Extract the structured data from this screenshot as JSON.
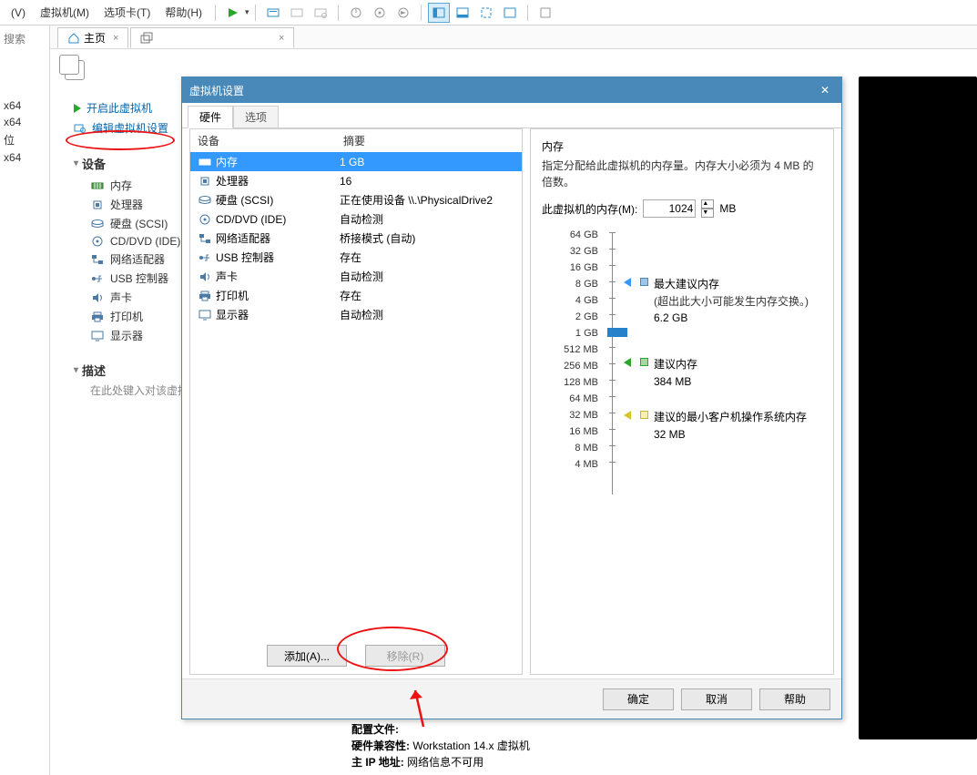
{
  "menubar": {
    "items": [
      "(V)",
      "虚拟机(M)",
      "选项卡(T)",
      "帮助(H)"
    ]
  },
  "left": {
    "search": "搜索",
    "frags": [
      "x64",
      "x64",
      "位",
      "x64"
    ]
  },
  "tabs": {
    "home_label": "主页"
  },
  "vm_actions": {
    "power_on": "开启此虚拟机",
    "edit_settings": "编辑虚拟机设置"
  },
  "sidebar": {
    "devices_header": "设备",
    "devices": [
      {
        "label": "内存",
        "icon": "memory-icon"
      },
      {
        "label": "处理器",
        "icon": "cpu-icon"
      },
      {
        "label": "硬盘 (SCSI)",
        "icon": "hdd-icon"
      },
      {
        "label": "CD/DVD (IDE)",
        "icon": "cd-icon"
      },
      {
        "label": "网络适配器",
        "icon": "network-icon"
      },
      {
        "label": "USB 控制器",
        "icon": "usb-icon"
      },
      {
        "label": "声卡",
        "icon": "sound-icon"
      },
      {
        "label": "打印机",
        "icon": "printer-icon"
      },
      {
        "label": "显示器",
        "icon": "display-icon"
      }
    ],
    "desc_header": "描述",
    "desc_hint": "在此处键入对该虚拟机"
  },
  "dialog": {
    "title": "虚拟机设置",
    "tab_hw": "硬件",
    "tab_opt": "选项",
    "col_device": "设备",
    "col_summary": "摘要",
    "rows": [
      {
        "label": "内存",
        "summary": "1 GB",
        "icon": "memory-icon"
      },
      {
        "label": "处理器",
        "summary": "16",
        "icon": "cpu-icon"
      },
      {
        "label": "硬盘 (SCSI)",
        "summary": "正在使用设备 \\\\.\\PhysicalDrive2",
        "icon": "hdd-icon"
      },
      {
        "label": "CD/DVD (IDE)",
        "summary": "自动检测",
        "icon": "cd-icon"
      },
      {
        "label": "网络适配器",
        "summary": "桥接模式 (自动)",
        "icon": "network-icon"
      },
      {
        "label": "USB 控制器",
        "summary": "存在",
        "icon": "usb-icon"
      },
      {
        "label": "声卡",
        "summary": "自动检测",
        "icon": "sound-icon"
      },
      {
        "label": "打印机",
        "summary": "存在",
        "icon": "printer-icon"
      },
      {
        "label": "显示器",
        "summary": "自动检测",
        "icon": "display-icon"
      }
    ],
    "btn_add": "添加(A)...",
    "btn_remove": "移除(R)",
    "mem": {
      "header": "内存",
      "desc": "指定分配给此虚拟机的内存量。内存大小必须为 4 MB 的倍数。",
      "field_label": "此虚拟机的内存(M):",
      "value": "1024",
      "unit": "MB",
      "ticks": [
        "64 GB",
        "32 GB",
        "16 GB",
        "8 GB",
        "4 GB",
        "2 GB",
        "1 GB",
        "512 MB",
        "256 MB",
        "128 MB",
        "64 MB",
        "32 MB",
        "16 MB",
        "8 MB",
        "4 MB"
      ],
      "markers": {
        "max": {
          "title": "最大建议内存",
          "note": "(超出此大小可能发生内存交换。)",
          "value": "6.2 GB"
        },
        "rec": {
          "title": "建议内存",
          "value": "384 MB"
        },
        "min": {
          "title": "建议的最小客户机操作系统内存",
          "value": "32 MB"
        }
      }
    },
    "footer": {
      "ok": "确定",
      "cancel": "取消",
      "help": "帮助"
    }
  },
  "bottom": {
    "cfg_label": "配置文件:",
    "compat_label": "硬件兼容性:",
    "compat_value": "Workstation 14.x 虚拟机",
    "ip_label": "主 IP 地址:",
    "ip_value": "网络信息不可用"
  }
}
